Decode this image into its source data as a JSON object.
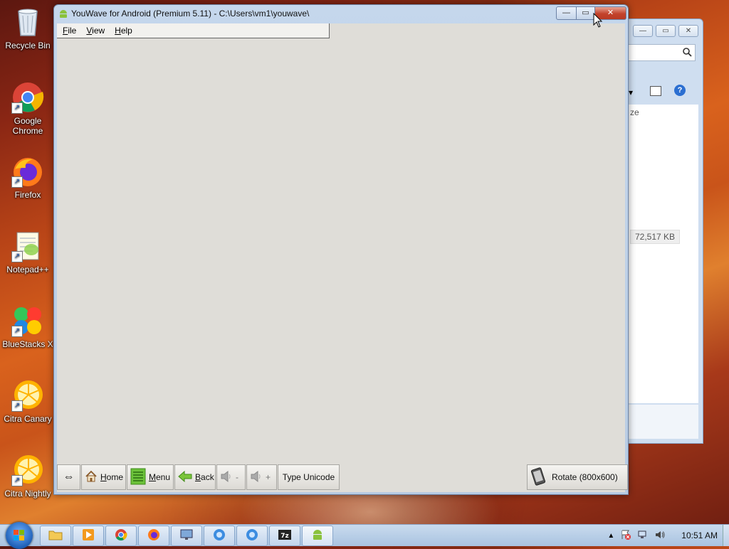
{
  "desktop": {
    "icons": [
      {
        "label": "Recycle Bin",
        "icon": "recycle-bin-icon"
      },
      {
        "label": "Google Chrome",
        "icon": "chrome-icon"
      },
      {
        "label": "Firefox",
        "icon": "firefox-icon"
      },
      {
        "label": "Notepad++",
        "icon": "notepad-plus-plus-icon"
      },
      {
        "label": "BlueStacks X",
        "icon": "bluestacks-icon"
      },
      {
        "label": "Citra Canary",
        "icon": "citra-canary-icon"
      },
      {
        "label": "Citra Nightly",
        "icon": "citra-nightly-icon"
      }
    ]
  },
  "background_window": {
    "column_header": "ze",
    "file_size": "72,517 KB"
  },
  "window": {
    "title": "YouWave for Android (Premium 5.11) - C:\\Users\\vm1\\youwave\\",
    "menu": {
      "file": "File",
      "view": "View",
      "help": "Help"
    },
    "buttons": {
      "home": "Home",
      "menu": "Menu",
      "back": "Back",
      "vol_down": "-",
      "vol_up": "+",
      "type_unicode": "Type Unicode",
      "rotate": "Rotate (800x600)"
    },
    "colors": {
      "client_bg": "#dfddd8",
      "titlebar": "#c5d7ec",
      "close": "#c3432c"
    }
  },
  "taskbar": {
    "items": [
      "windows-explorer",
      "media-player",
      "google-chrome",
      "firefox",
      "remote-desktop",
      "bluestacks-x",
      "bluestacks",
      "7-zip",
      "youwave-android"
    ],
    "clock": "10:51 AM"
  }
}
